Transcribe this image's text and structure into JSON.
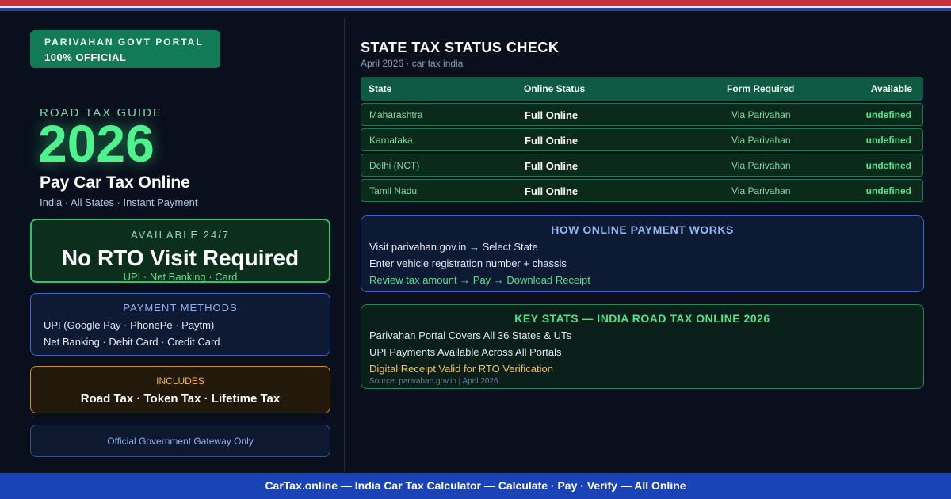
{
  "badge": {
    "line1": "PARIVAHAN GOVT PORTAL",
    "line2": "100% OFFICIAL"
  },
  "hero": {
    "label": "ROAD TAX GUIDE",
    "year": "2026",
    "headline": "Pay Car Tax Online",
    "subline": "India · All States · Instant Payment"
  },
  "availability": {
    "label": "AVAILABLE 24/7",
    "headline": "No RTO Visit Required",
    "methods": "UPI · Net Banking · Card"
  },
  "payment_methods": {
    "title": "PAYMENT METHODS",
    "lines": [
      "UPI (Google Pay · PhonePe · Paytm)",
      "Net Banking · Debit Card · Credit Card"
    ]
  },
  "includes": {
    "title": "INCLUDES",
    "value": "Road Tax · Token Tax · Lifetime Tax"
  },
  "gateway_note": "Official Government Gateway Only",
  "status_check": {
    "title": "STATE TAX STATUS CHECK",
    "subtitle": "April 2026 · car tax india",
    "columns": [
      "State",
      "Online Status",
      "Form Required",
      "Available"
    ],
    "rows": [
      [
        "Maharashtra",
        "Full Online",
        "Via Parivahan",
        "undefined"
      ],
      [
        "Karnataka",
        "Full Online",
        "Via Parivahan",
        "undefined"
      ],
      [
        "Delhi (NCT)",
        "Full Online",
        "Via Parivahan",
        "undefined"
      ],
      [
        "Tamil Nadu",
        "Full Online",
        "Via Parivahan",
        "undefined"
      ]
    ]
  },
  "how_it_works": {
    "title": "HOW ONLINE PAYMENT WORKS",
    "lines": [
      "Visit parivahan.gov.in → Select State",
      "Enter vehicle registration number + chassis",
      "Review tax amount → Pay → Download Receipt"
    ]
  },
  "key_stats": {
    "title": "KEY STATS — INDIA ROAD TAX ONLINE 2026",
    "lines": [
      "Parivahan Portal Covers All 36 States & UTs",
      "UPI Payments Available Across All Portals",
      "Digital Receipt Valid for RTO Verification"
    ],
    "source": "Source: parivahan.gov.in | April 2026"
  },
  "footer": "CarTax.online — India Car Tax Calculator — Calculate · Pay · Verify — All Online",
  "colors": {
    "accent_green": "#4ef38e",
    "accent_blue": "#3b64c9",
    "accent_amber": "#c4922e",
    "footer_blue": "#1b43b8"
  }
}
